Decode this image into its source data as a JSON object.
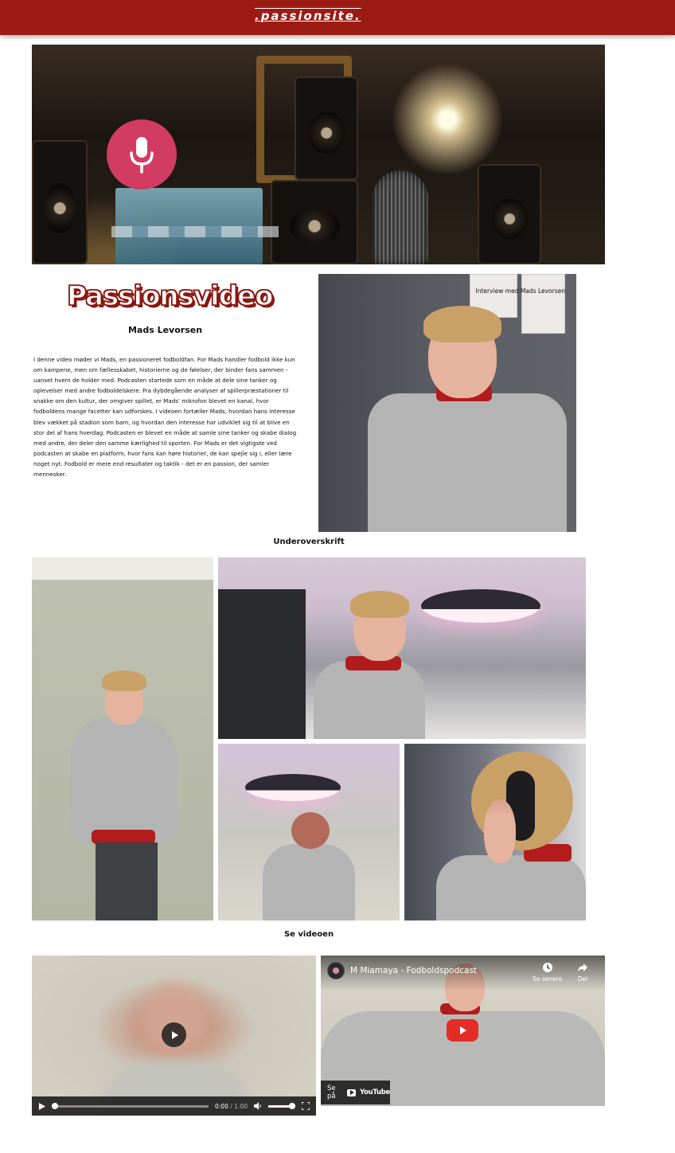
{
  "header": {
    "logo": ".passionsite.",
    "background_color": "#9c1c14"
  },
  "hero": {
    "icon": "microphone-icon",
    "badge_color": "#d23c63"
  },
  "intro": {
    "title": "Passionsvideo",
    "subtitle": "Mads Levorsen",
    "body": "I denne video møder vi Mads, en passioneret fodboldfan. For Mads handler fodbold ikke kun om kampene, men om fællesskabet, historierne og de følelser, der binder fans sammen - uanset hvem de holder med. Podcasten startede som en måde at dele sine tanker og oplevelser med andre fodboldelskere. Fra dybdegående analyser af spillerpræstationer til snakke om den kultur, der omgiver spillet, er Mads' mikrofon blevet en kanal, hvor fodboldens mange facetter kan udforskes. I videoen fortæller Mads, hvordan hans interesse blev vækket på stadion som barn, og hvordan den interesse har udviklet sig til at blive en stor del af hans hverdag. Podcasten er blevet en måde at samle sine tanker og skabe dialog med andre, der deler den samme kærlighed til sporten. For Mads er det vigtigste ved podcasten at skabe en platform, hvor fans kan høre historier, de kan spejle sig i, eller lære noget nyt. Fodbold er mere end resultater og taktik - det er en passion, der samler mennesker.",
    "portrait_caption": "Interview med Mads Levorsen"
  },
  "gallery": {
    "heading": "Underoverskrift"
  },
  "videos": {
    "heading": "Se videoen",
    "player": {
      "current_time": "0:00",
      "duration": "/ 1:00"
    },
    "youtube": {
      "title": "M Miamaya - Fodboldspodcast",
      "watch_later": "Se senere",
      "share": "Del",
      "watch_on": "Se på",
      "brand": "YouTube",
      "play_color": "#e52d27"
    }
  }
}
